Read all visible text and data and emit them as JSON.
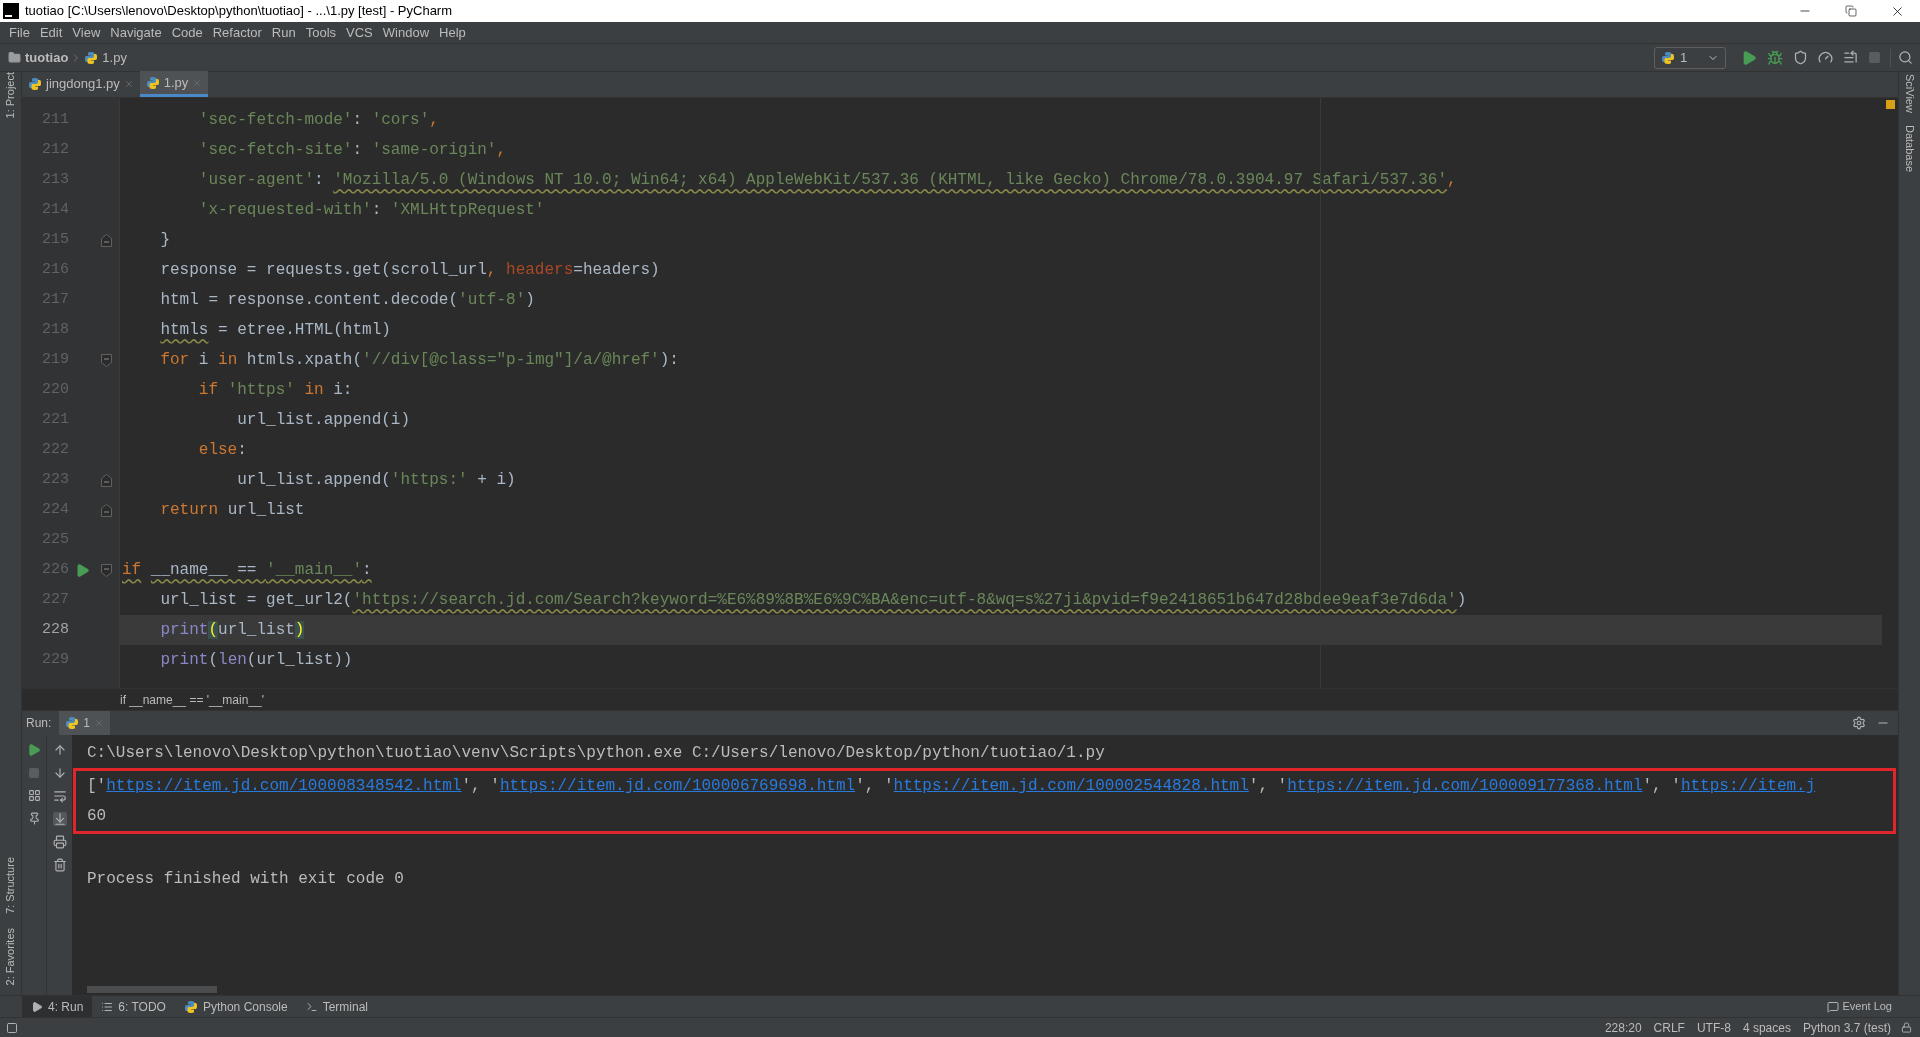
{
  "window": {
    "title": "tuotiao [C:\\Users\\lenovo\\Desktop\\python\\tuotiao] - ...\\1.py [test] - PyCharm"
  },
  "menu": [
    "File",
    "Edit",
    "View",
    "Navigate",
    "Code",
    "Refactor",
    "Run",
    "Tools",
    "VCS",
    "Window",
    "Help"
  ],
  "breadcrumb": [
    {
      "label": "tuotiao",
      "kind": "folder"
    },
    {
      "label": "1.py",
      "kind": "file"
    }
  ],
  "toolbar": {
    "run_config": "1"
  },
  "left_strip": [
    {
      "label": "1: Project",
      "kind": "top"
    },
    {
      "label": "7: Structure",
      "kind": "bottom"
    },
    {
      "label": "2: Favorites",
      "kind": "bottom"
    }
  ],
  "right_strip": [
    "SciView",
    "Database"
  ],
  "tabs": [
    {
      "label": "jingdong1.py",
      "selected": false
    },
    {
      "label": "1.py",
      "selected": true
    }
  ],
  "editor": {
    "lines": [
      {
        "number": "211",
        "kind": "plain",
        "current": false,
        "tokens": [
          {
            "kind": "string",
            "text": "        'sec-fetch-mode'"
          },
          {
            "kind": "text",
            "text": ": "
          },
          {
            "kind": "string",
            "text": "'cors'"
          },
          {
            "kind": "punct",
            "text": ","
          }
        ]
      },
      {
        "number": "212",
        "kind": "plain",
        "current": false,
        "tokens": [
          {
            "kind": "string",
            "text": "        'sec-fetch-site'"
          },
          {
            "kind": "text",
            "text": ": "
          },
          {
            "kind": "string",
            "text": "'same-origin'"
          },
          {
            "kind": "punct",
            "text": ","
          }
        ]
      },
      {
        "number": "213",
        "kind": "plain",
        "current": false,
        "tokens": [
          {
            "kind": "string",
            "text": "        'user-agent'"
          },
          {
            "kind": "text",
            "text": ": "
          },
          {
            "kind": "string_warn",
            "text": "'Mozilla/5.0 (Windows NT 10.0; Win64; x64) AppleWebKit/537.36 (KHTML, like Gecko) Chrome/78.0.3904.97 Safari/537.36'"
          },
          {
            "kind": "punct",
            "text": ","
          }
        ]
      },
      {
        "number": "214",
        "kind": "plain",
        "current": false,
        "tokens": [
          {
            "kind": "string",
            "text": "        'x-requested-with'"
          },
          {
            "kind": "text",
            "text": ": "
          },
          {
            "kind": "string",
            "text": "'XMLHttpRequest'"
          }
        ]
      },
      {
        "number": "215",
        "kind": "fold_end",
        "current": false,
        "tokens": [
          {
            "kind": "text",
            "text": "    }"
          }
        ]
      },
      {
        "number": "216",
        "kind": "plain",
        "current": false,
        "tokens": [
          {
            "kind": "text",
            "text": "    response = requests.get(scroll_url"
          },
          {
            "kind": "punct",
            "text": ", "
          },
          {
            "kind": "param",
            "text": "headers"
          },
          {
            "kind": "text",
            "text": "=headers)"
          }
        ]
      },
      {
        "number": "217",
        "kind": "plain",
        "current": false,
        "tokens": [
          {
            "kind": "text",
            "text": "    html = response.content.decode("
          },
          {
            "kind": "string",
            "text": "'utf-8'"
          },
          {
            "kind": "text",
            "text": ")"
          }
        ]
      },
      {
        "number": "218",
        "kind": "plain",
        "current": false,
        "tokens": [
          {
            "kind": "text_warn",
            "text": "    htmls"
          },
          {
            "kind": "text",
            "text": " = etree.HTML(html)"
          }
        ]
      },
      {
        "number": "219",
        "kind": "fold_start",
        "current": false,
        "tokens": [
          {
            "kind": "keyword",
            "text": "    for"
          },
          {
            "kind": "text",
            "text": " i "
          },
          {
            "kind": "keyword",
            "text": "in"
          },
          {
            "kind": "text",
            "text": " htmls.xpath("
          },
          {
            "kind": "string",
            "text": "'//div[@class=\"p-img\"]/a/@href'"
          },
          {
            "kind": "text",
            "text": "):"
          }
        ]
      },
      {
        "number": "220",
        "kind": "plain",
        "current": false,
        "tokens": [
          {
            "kind": "keyword",
            "text": "        if"
          },
          {
            "kind": "string",
            "text": " 'https'"
          },
          {
            "kind": "keyword",
            "text": " in"
          },
          {
            "kind": "text",
            "text": " i:"
          }
        ]
      },
      {
        "number": "221",
        "kind": "plain",
        "current": false,
        "tokens": [
          {
            "kind": "text",
            "text": "            url_list.append(i)"
          }
        ]
      },
      {
        "number": "222",
        "kind": "plain",
        "current": false,
        "tokens": [
          {
            "kind": "keyword",
            "text": "        else"
          },
          {
            "kind": "text",
            "text": ":"
          }
        ]
      },
      {
        "number": "223",
        "kind": "fold_end",
        "current": false,
        "tokens": [
          {
            "kind": "text",
            "text": "            url_list.append("
          },
          {
            "kind": "string",
            "text": "'https:'"
          },
          {
            "kind": "text",
            "text": " + i)"
          }
        ]
      },
      {
        "number": "224",
        "kind": "fold_end",
        "current": false,
        "tokens": [
          {
            "kind": "keyword",
            "text": "    return"
          },
          {
            "kind": "text",
            "text": " url_list"
          }
        ]
      },
      {
        "number": "225",
        "kind": "plain",
        "current": false
      },
      {
        "number": "226",
        "kind": "run_fold_start",
        "current": false,
        "tokens": [
          {
            "kind": "keyword_warn",
            "text": "if"
          },
          {
            "kind": "text_warn",
            "text": " __name__ == "
          },
          {
            "kind": "string_warn",
            "text": "'__main__'"
          },
          {
            "kind": "text_warn",
            "text": ":"
          }
        ]
      },
      {
        "number": "227",
        "kind": "plain",
        "current": false,
        "tokens": [
          {
            "kind": "text",
            "text": "    url_list = get_url2("
          },
          {
            "kind": "string_warn",
            "text": "'https://search.jd.com/Search?keyword=%E6%89%8B%E6%9C%BA&enc=utf-8&wq=s%27ji&pvid=f9e2418651b647d28bdee9eaf3e7d6da'"
          },
          {
            "kind": "text",
            "text": ")"
          }
        ]
      },
      {
        "number": "228",
        "kind": "plain",
        "current": true,
        "tokens": [
          {
            "kind": "builtin",
            "text": "    print"
          },
          {
            "kind": "brace",
            "text": "("
          },
          {
            "kind": "text",
            "text": "url_list"
          },
          {
            "kind": "brace",
            "text": ")"
          }
        ]
      },
      {
        "number": "229",
        "kind": "plain",
        "current": false,
        "tokens": [
          {
            "kind": "builtin",
            "text": "    print"
          },
          {
            "kind": "text",
            "text": "("
          },
          {
            "kind": "builtin",
            "text": "len"
          },
          {
            "kind": "text",
            "text": "(url_list))"
          }
        ]
      }
    ],
    "breadcrumb": "if __name__ == '__main__'"
  },
  "run_panel": {
    "label": "Run:",
    "tab": "1",
    "lines": [
      {
        "kind": "command",
        "boxed": false,
        "tokens": [
          {
            "kind": "text",
            "text": "C:\\Users\\lenovo\\Desktop\\python\\tuotiao\\venv\\Scripts\\python.exe C:/Users/lenovo/Desktop/python/tuotiao/1.py"
          }
        ]
      },
      {
        "kind": "output",
        "boxed": true,
        "tokens": [
          {
            "kind": "text",
            "text": "['"
          },
          {
            "kind": "link",
            "text": "https://item.jd.com/100008348542.html"
          },
          {
            "kind": "text",
            "text": "', '"
          },
          {
            "kind": "link",
            "text": "https://item.jd.com/100006769698.html"
          },
          {
            "kind": "text",
            "text": "', '"
          },
          {
            "kind": "link",
            "text": "https://item.jd.com/100002544828.html"
          },
          {
            "kind": "text",
            "text": "', '"
          },
          {
            "kind": "link",
            "text": "https://item.jd.com/100009177368.html"
          },
          {
            "kind": "text",
            "text": "', '"
          },
          {
            "kind": "link",
            "text": "https://item.j"
          }
        ]
      },
      {
        "kind": "output",
        "boxed": true,
        "tokens": [
          {
            "kind": "text",
            "text": "60"
          }
        ]
      },
      {
        "kind": "exit",
        "boxed": false,
        "tokens": [
          {
            "kind": "text",
            "text": "Process finished with exit code 0"
          }
        ]
      }
    ]
  },
  "tool_tabs": [
    {
      "label": "4: Run",
      "kind": "run",
      "selected": true
    },
    {
      "label": "6: TODO",
      "kind": "todo",
      "selected": false
    },
    {
      "label": "Python Console",
      "kind": "console",
      "selected": false
    },
    {
      "label": "Terminal",
      "kind": "terminal",
      "selected": false
    }
  ],
  "status": {
    "event_log": "Event Log",
    "items": [
      "228:20",
      "CRLF",
      "UTF-8",
      "4 spaces",
      "Python 3.7 (test)"
    ]
  }
}
